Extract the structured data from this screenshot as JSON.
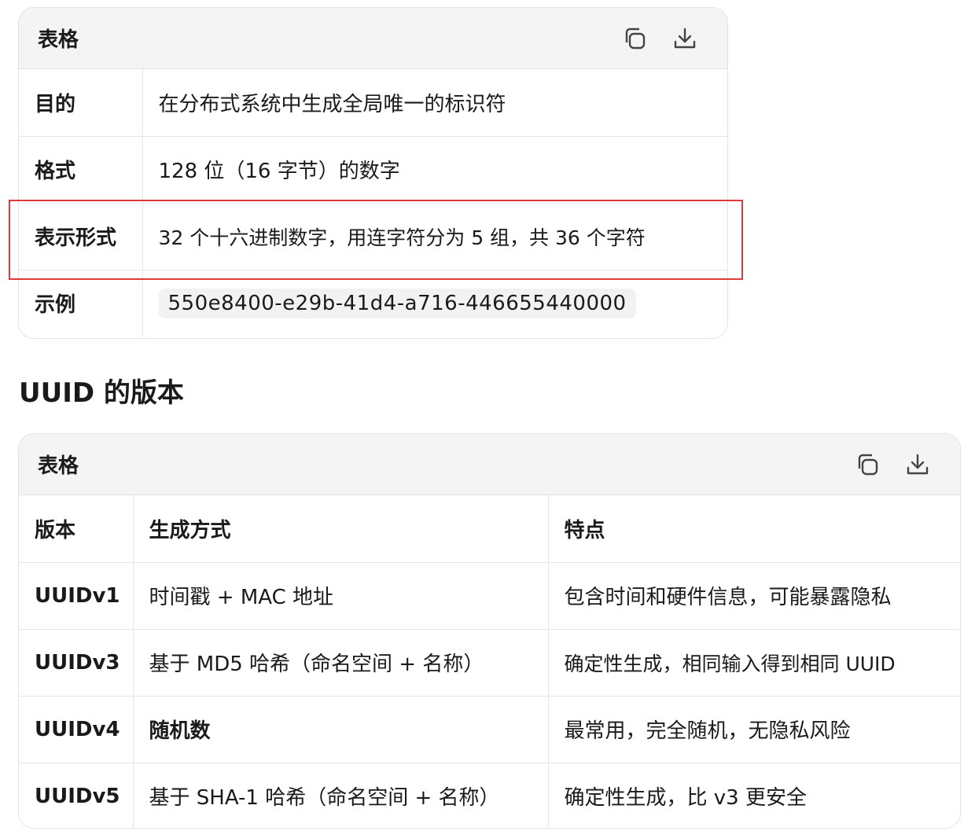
{
  "table1": {
    "header_title": "表格",
    "rows": [
      {
        "key": "目的",
        "value": "在分布式系统中生成全局唯一的标识符"
      },
      {
        "key": "格式",
        "value": "128 位（16 字节）的数字"
      },
      {
        "key": "表示形式",
        "value": "32 个十六进制数字，用连字符分为 5 组，共 36 个字符"
      },
      {
        "key": "示例",
        "value": "550e8400-e29b-41d4-a716-446655440000"
      }
    ]
  },
  "section_heading": "UUID 的版本",
  "table2": {
    "header_title": "表格",
    "columns": [
      "版本",
      "生成方式",
      "特点"
    ],
    "rows": [
      {
        "version": "UUIDv1",
        "method": "时间戳 + MAC 地址",
        "feature": "包含时间和硬件信息，可能暴露隐私"
      },
      {
        "version": "UUIDv3",
        "method": "基于 MD5 哈希（命名空间 + 名称）",
        "feature": "确定性生成，相同输入得到相同 UUID"
      },
      {
        "version": "UUIDv4",
        "method": "随机数",
        "feature": "最常用，完全随机，无隐私风险"
      },
      {
        "version": "UUIDv5",
        "method": "基于 SHA-1 哈希（命名空间 + 名称）",
        "feature": "确定性生成，比 v3 更安全"
      }
    ]
  },
  "icons": {
    "copy": "copy-icon",
    "download": "download-icon"
  },
  "colors": {
    "highlight": "#e03a3a",
    "header_bg": "#f4f4f4",
    "border": "#e3e3e3"
  }
}
